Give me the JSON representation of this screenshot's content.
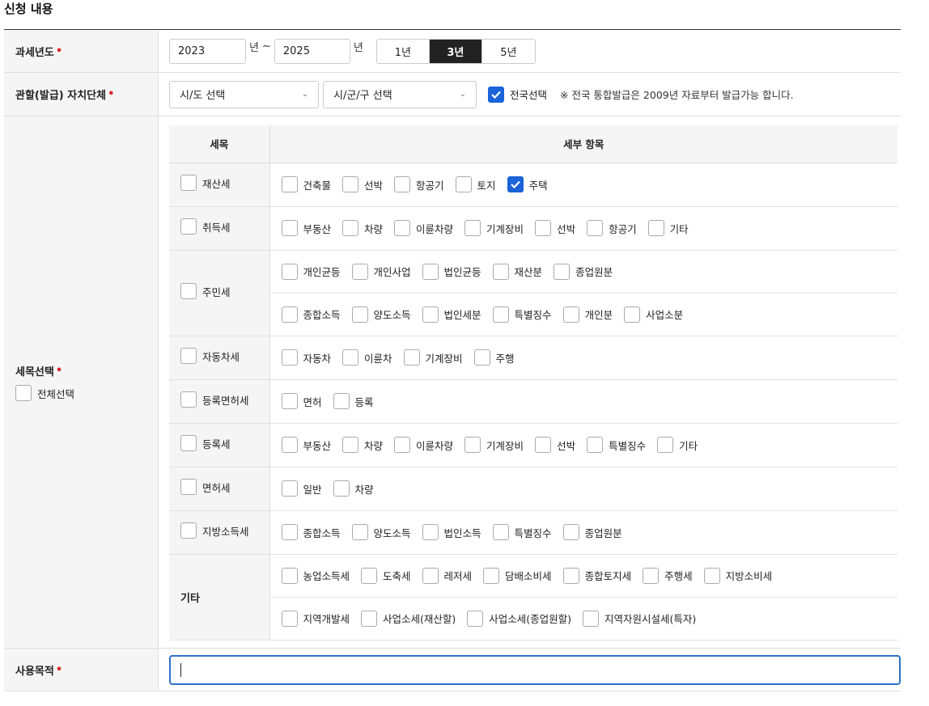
{
  "section_title": "신청 내용",
  "colors": {
    "accent": "#1a63d8",
    "required": "#e0272a",
    "active_segment": "#222222",
    "focus_border": "#2f6fc9"
  },
  "year": {
    "label": "과세년도",
    "required_mark": "•",
    "from_value": "2023",
    "from_unit": "년",
    "tilde": "~",
    "to_value": "2025",
    "to_unit": "년",
    "ranges": [
      {
        "label": "1년",
        "active": false
      },
      {
        "label": "3년",
        "active": true
      },
      {
        "label": "5년",
        "active": false
      }
    ]
  },
  "region": {
    "label": "관할(발급) 자치단체",
    "required_mark": "•",
    "sido_select": "시/도 선택",
    "sigungu_select": "시/군/구 선택",
    "nationwide_label": "전국선택",
    "nationwide_checked": true,
    "note": "※ 전국 통합발급은 2009년 자료부터 발급가능 합니다."
  },
  "tax": {
    "label": "세목선택",
    "required_mark": "•",
    "select_all_label": "전체선택",
    "header_category": "세목",
    "header_items": "세부 항목",
    "rows": [
      {
        "category": "재산세",
        "lines": [
          [
            {
              "label": "건축물",
              "checked": false
            },
            {
              "label": "선박",
              "checked": false
            },
            {
              "label": "항공기",
              "checked": false
            },
            {
              "label": "토지",
              "checked": false
            },
            {
              "label": "주택",
              "checked": true
            }
          ]
        ]
      },
      {
        "category": "취득세",
        "lines": [
          [
            {
              "label": "부동산",
              "checked": false
            },
            {
              "label": "차량",
              "checked": false
            },
            {
              "label": "이륜차량",
              "checked": false
            },
            {
              "label": "기계장비",
              "checked": false
            },
            {
              "label": "선박",
              "checked": false
            },
            {
              "label": "항공기",
              "checked": false
            },
            {
              "label": "기타",
              "checked": false
            }
          ]
        ]
      },
      {
        "category": "주민세",
        "lines": [
          [
            {
              "label": "개인균등",
              "checked": false
            },
            {
              "label": "개인사업",
              "checked": false
            },
            {
              "label": "법인균등",
              "checked": false
            },
            {
              "label": "재산분",
              "checked": false
            },
            {
              "label": "종업원분",
              "checked": false
            }
          ],
          [
            {
              "label": "종합소득",
              "checked": false
            },
            {
              "label": "양도소득",
              "checked": false
            },
            {
              "label": "법인세분",
              "checked": false
            },
            {
              "label": "특별징수",
              "checked": false
            },
            {
              "label": "개인분",
              "checked": false
            },
            {
              "label": "사업소분",
              "checked": false
            }
          ]
        ]
      },
      {
        "category": "자동차세",
        "lines": [
          [
            {
              "label": "자동차",
              "checked": false
            },
            {
              "label": "이륜차",
              "checked": false
            },
            {
              "label": "기계장비",
              "checked": false
            },
            {
              "label": "주행",
              "checked": false
            }
          ]
        ]
      },
      {
        "category": "등록면허세",
        "lines": [
          [
            {
              "label": "면허",
              "checked": false
            },
            {
              "label": "등록",
              "checked": false
            }
          ]
        ]
      },
      {
        "category": "등록세",
        "lines": [
          [
            {
              "label": "부동산",
              "checked": false
            },
            {
              "label": "차량",
              "checked": false
            },
            {
              "label": "이륜차량",
              "checked": false
            },
            {
              "label": "기계장비",
              "checked": false
            },
            {
              "label": "선박",
              "checked": false
            },
            {
              "label": "특별징수",
              "checked": false
            },
            {
              "label": "기타",
              "checked": false
            }
          ]
        ]
      },
      {
        "category": "면허세",
        "lines": [
          [
            {
              "label": "일반",
              "checked": false
            },
            {
              "label": "차량",
              "checked": false
            }
          ]
        ]
      },
      {
        "category": "지방소득세",
        "lines": [
          [
            {
              "label": "종합소득",
              "checked": false
            },
            {
              "label": "양도소득",
              "checked": false
            },
            {
              "label": "법인소득",
              "checked": false
            },
            {
              "label": "특별징수",
              "checked": false
            },
            {
              "label": "종업원분",
              "checked": false
            }
          ]
        ]
      }
    ],
    "other": {
      "category": "기타",
      "lines": [
        [
          {
            "label": "농업소득세",
            "checked": false
          },
          {
            "label": "도축세",
            "checked": false
          },
          {
            "label": "레저세",
            "checked": false
          },
          {
            "label": "담배소비세",
            "checked": false
          },
          {
            "label": "종합토지세",
            "checked": false
          },
          {
            "label": "주행세",
            "checked": false
          },
          {
            "label": "지방소비세",
            "checked": false
          }
        ],
        [
          {
            "label": "지역개발세",
            "checked": false
          },
          {
            "label": "사업소세(재산할)",
            "checked": false
          },
          {
            "label": "사업소세(종업원할)",
            "checked": false
          },
          {
            "label": "지역자원시설세(특자)",
            "checked": false
          }
        ]
      ]
    }
  },
  "purpose": {
    "label": "사용목적",
    "required_mark": "•",
    "value": ""
  }
}
